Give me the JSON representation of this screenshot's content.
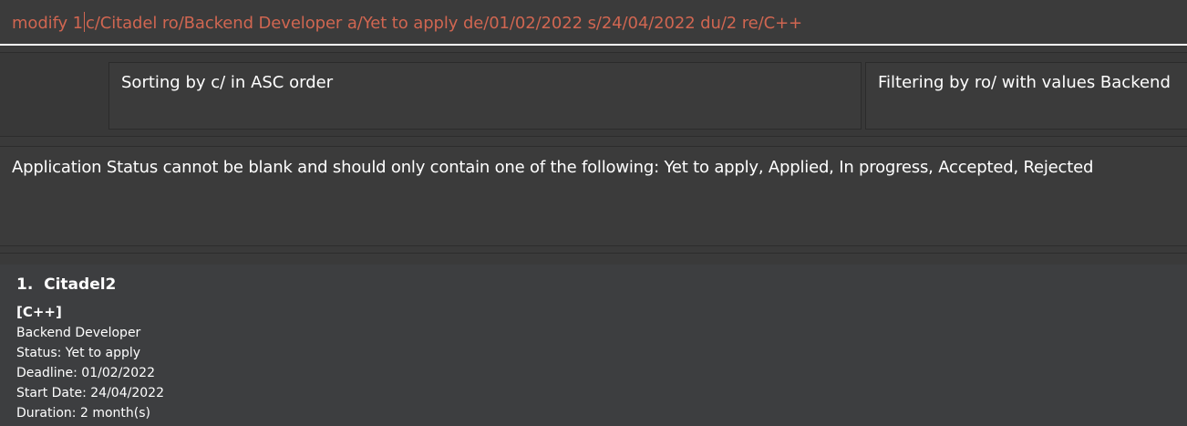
{
  "command_box": {
    "before_caret": "modify 1",
    "after_caret": "c/Citadel ro/Backend Developer a/Yet to apply de/01/02/2022 s/24/04/2022 du/2 re/C++"
  },
  "sort_status": "Sorting by c/ in ASC order",
  "filter_status": "Filtering by ro/ with values Backend",
  "result_message": "Application Status cannot be blank and should only contain one of the following: Yet to apply, Applied, In progress, Accepted, Rejected",
  "list": {
    "items": [
      {
        "title": "1.  Citadel2",
        "tag": "[C++]",
        "role": "Backend Developer",
        "status": "Status: Yet to apply",
        "deadline": "Deadline: 01/02/2022",
        "start_date": "Start Date: 24/04/2022",
        "duration": "Duration: 2 month(s)"
      }
    ]
  },
  "colors": {
    "command_text": "#d06651",
    "background": "#3a3a3a",
    "text": "#ffffff"
  }
}
